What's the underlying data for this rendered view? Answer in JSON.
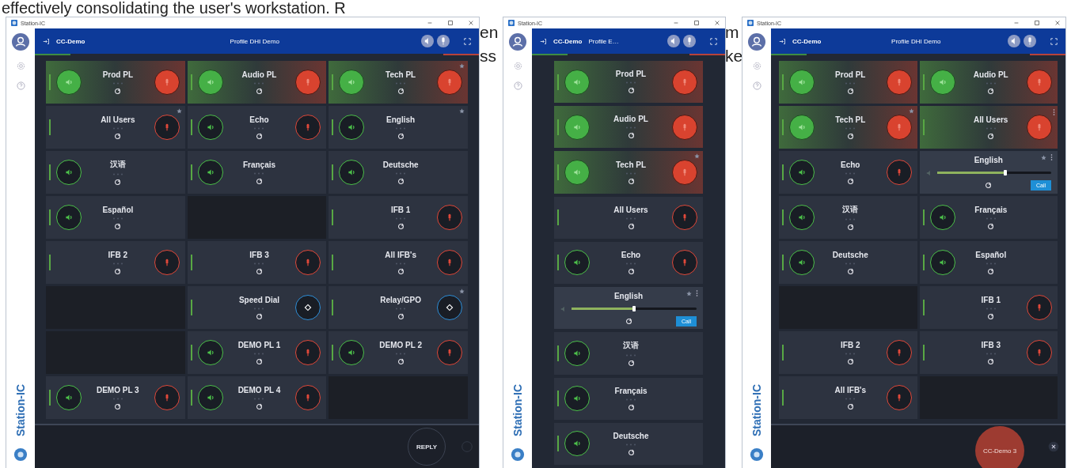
{
  "background_text": {
    "top_line": "effectively consolidating the user's workstation. R",
    "fragments": [
      {
        "lines": [
          "en",
          "ss"
        ]
      },
      {
        "lines": [
          "m",
          "ke"
        ]
      }
    ]
  },
  "windows": [
    {
      "title": "Station-IC",
      "logo_text": "Station-IC",
      "account": "CC-Demo",
      "profile": "Profile DHI Demo",
      "bottom": {
        "kind": "reply",
        "label": "REPLY"
      },
      "tiles": [
        {
          "kind": "partyline",
          "label": "Prod PL",
          "listen_on": true,
          "talk_on": true,
          "favorite": false,
          "menu": false
        },
        {
          "kind": "partyline",
          "label": "Audio PL",
          "listen_on": true,
          "talk_on": true,
          "favorite": false,
          "menu": false
        },
        {
          "kind": "partyline",
          "label": "Tech PL",
          "listen_on": true,
          "talk_on": true,
          "favorite": true,
          "menu": false
        },
        {
          "kind": "talk",
          "label": "All Users",
          "talk_on": false,
          "favorite": true,
          "menu": false
        },
        {
          "kind": "partyline",
          "label": "Echo",
          "listen_on": false,
          "talk_on": false,
          "favorite": false,
          "menu": false
        },
        {
          "kind": "listen",
          "label": "English",
          "listen_on": false,
          "favorite": true,
          "menu": false
        },
        {
          "kind": "listen",
          "label": "汉语",
          "listen_on": false,
          "favorite": false,
          "menu": false
        },
        {
          "kind": "listen",
          "label": "Français",
          "listen_on": false,
          "favorite": false,
          "menu": false
        },
        {
          "kind": "listen",
          "label": "Deutsche",
          "listen_on": false,
          "favorite": false,
          "menu": false
        },
        {
          "kind": "listen",
          "label": "Español",
          "listen_on": false,
          "favorite": false,
          "menu": false
        },
        {
          "kind": "empty"
        },
        {
          "kind": "talk",
          "label": "IFB 1",
          "talk_on": false,
          "favorite": false,
          "menu": false
        },
        {
          "kind": "talk",
          "label": "IFB 2",
          "talk_on": false,
          "favorite": false,
          "menu": false
        },
        {
          "kind": "talk",
          "label": "IFB 3",
          "talk_on": false,
          "favorite": false,
          "menu": false
        },
        {
          "kind": "talk",
          "label": "All IFB's",
          "talk_on": false,
          "favorite": false,
          "menu": false
        },
        {
          "kind": "empty"
        },
        {
          "kind": "dial",
          "label": "Speed Dial",
          "favorite": false,
          "menu": false
        },
        {
          "kind": "dial",
          "label": "Relay/GPO",
          "favorite": true,
          "menu": false
        },
        {
          "kind": "empty"
        },
        {
          "kind": "partyline",
          "label": "DEMO PL 1",
          "listen_on": false,
          "talk_on": false,
          "favorite": false,
          "menu": false
        },
        {
          "kind": "partyline",
          "label": "DEMO PL 2",
          "listen_on": false,
          "talk_on": false,
          "favorite": false,
          "menu": false
        },
        {
          "kind": "partyline",
          "label": "DEMO PL 3",
          "listen_on": false,
          "talk_on": false,
          "favorite": false,
          "menu": false
        },
        {
          "kind": "partyline",
          "label": "DEMO PL 4",
          "listen_on": false,
          "talk_on": false,
          "favorite": false,
          "menu": false
        },
        {
          "kind": "empty"
        }
      ]
    },
    {
      "title": "Station-IC",
      "logo_text": "Station-IC",
      "account": "CC-Demo",
      "profile": "Profile E…",
      "tiles": [
        {
          "kind": "partyline",
          "label": "Prod PL",
          "listen_on": true,
          "talk_on": true,
          "favorite": false,
          "menu": false
        },
        {
          "kind": "partyline",
          "label": "Audio PL",
          "listen_on": true,
          "talk_on": true,
          "favorite": false,
          "menu": false
        },
        {
          "kind": "partyline",
          "label": "Tech PL",
          "listen_on": true,
          "talk_on": true,
          "favorite": true,
          "menu": false
        },
        {
          "kind": "talk",
          "label": "All Users",
          "talk_on": false,
          "favorite": false,
          "menu": false
        },
        {
          "kind": "partyline",
          "label": "Echo",
          "listen_on": false,
          "talk_on": false,
          "favorite": false,
          "menu": false
        },
        {
          "kind": "expanded",
          "label": "English",
          "level": 0.5,
          "call_label": "Call",
          "favorite": true,
          "menu": true
        },
        {
          "kind": "listen",
          "label": "汉语",
          "listen_on": false,
          "favorite": false,
          "menu": false
        },
        {
          "kind": "listen",
          "label": "Français",
          "listen_on": false,
          "favorite": false,
          "menu": false
        },
        {
          "kind": "listen",
          "label": "Deutsche",
          "listen_on": false,
          "favorite": false,
          "menu": false
        }
      ]
    },
    {
      "title": "Station-IC",
      "logo_text": "Station-IC",
      "account": "CC-Demo",
      "profile": "Profile DHI Demo",
      "bottom": {
        "kind": "call",
        "label": "CC-Demo 3"
      },
      "tiles": [
        {
          "kind": "partyline",
          "label": "Prod PL",
          "listen_on": true,
          "talk_on": true,
          "favorite": false,
          "menu": false
        },
        {
          "kind": "partyline",
          "label": "Audio PL",
          "listen_on": true,
          "talk_on": true,
          "favorite": false,
          "menu": false
        },
        {
          "kind": "partyline",
          "label": "Tech PL",
          "listen_on": true,
          "talk_on": true,
          "favorite": true,
          "menu": false
        },
        {
          "kind": "talk",
          "label": "All Users",
          "talk_on": true,
          "favorite": false,
          "menu": true
        },
        {
          "kind": "partyline",
          "label": "Echo",
          "listen_on": false,
          "talk_on": false,
          "favorite": false,
          "menu": false
        },
        {
          "kind": "expanded",
          "label": "English",
          "level": 0.6,
          "call_label": "Call",
          "favorite": true,
          "menu": true
        },
        {
          "kind": "listen",
          "label": "汉语",
          "listen_on": false,
          "favorite": false,
          "menu": false
        },
        {
          "kind": "listen",
          "label": "Français",
          "listen_on": false,
          "favorite": false,
          "menu": false
        },
        {
          "kind": "listen",
          "label": "Deutsche",
          "listen_on": false,
          "favorite": false,
          "menu": false
        },
        {
          "kind": "listen",
          "label": "Español",
          "listen_on": false,
          "favorite": false,
          "menu": false
        },
        {
          "kind": "empty"
        },
        {
          "kind": "talk",
          "label": "IFB 1",
          "talk_on": false,
          "favorite": false,
          "menu": false
        },
        {
          "kind": "talk",
          "label": "IFB 2",
          "talk_on": false,
          "favorite": false,
          "menu": false
        },
        {
          "kind": "talk",
          "label": "IFB 3",
          "talk_on": false,
          "favorite": false,
          "menu": false
        },
        {
          "kind": "talk",
          "label": "All IFB's",
          "talk_on": false,
          "favorite": false,
          "menu": false
        },
        {
          "kind": "empty"
        }
      ]
    }
  ]
}
